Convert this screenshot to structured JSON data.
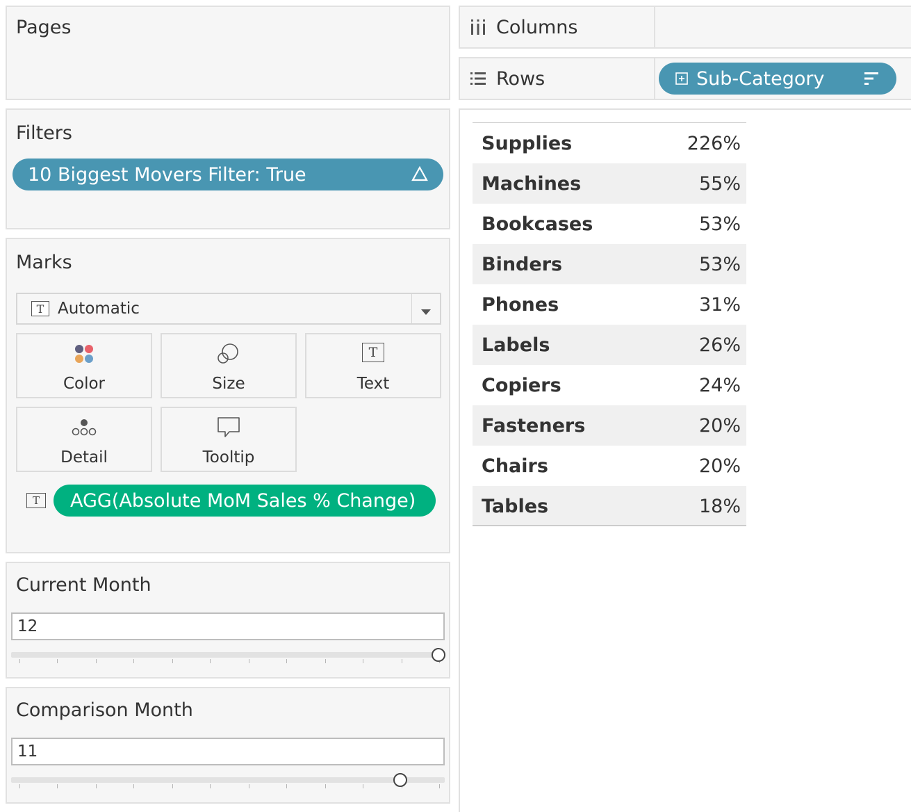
{
  "pages": {
    "title": "Pages"
  },
  "filters": {
    "title": "Filters",
    "pill_label": "10 Biggest Movers Filter: True",
    "pill_icon": "delta-icon"
  },
  "marks": {
    "title": "Marks",
    "mark_type": "Automatic",
    "buttons": {
      "color": "Color",
      "size": "Size",
      "text": "Text",
      "detail": "Detail",
      "tooltip": "Tooltip"
    },
    "text_field_pill": "AGG(Absolute MoM Sales % Change)",
    "text_field_icon": "text-mark-icon"
  },
  "current_month": {
    "title": "Current Month",
    "value": "12",
    "slider_fraction": 1.0
  },
  "comparison_month": {
    "title": "Comparison Month",
    "value": "11",
    "slider_fraction": 0.9
  },
  "shelves": {
    "columns_label": "Columns",
    "rows_label": "Rows",
    "rows_pill": "Sub-Category"
  },
  "table": {
    "rows": [
      {
        "name": "Supplies",
        "value": "226%"
      },
      {
        "name": "Machines",
        "value": "55%"
      },
      {
        "name": "Bookcases",
        "value": "53%"
      },
      {
        "name": "Binders",
        "value": "53%"
      },
      {
        "name": "Phones",
        "value": "31%"
      },
      {
        "name": "Labels",
        "value": "26%"
      },
      {
        "name": "Copiers",
        "value": "24%"
      },
      {
        "name": "Fasteners",
        "value": "20%"
      },
      {
        "name": "Chairs",
        "value": "20%"
      },
      {
        "name": "Tables",
        "value": "18%"
      }
    ]
  },
  "colors": {
    "pill_blue": "#4996b2",
    "pill_green": "#00b180",
    "panel_bg": "#f6f6f6",
    "panel_border": "#e1e1e1",
    "row_band": "#f0f0f0"
  }
}
